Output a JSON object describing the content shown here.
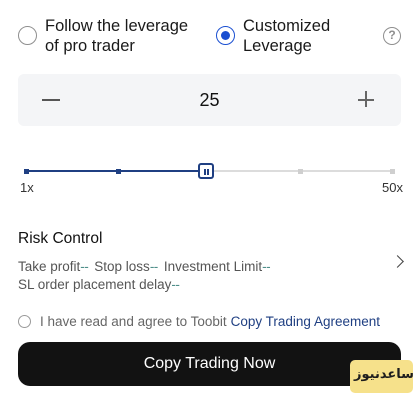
{
  "leverage_mode": {
    "options": [
      {
        "label": "Follow the leverage\nof pro trader",
        "selected": false
      },
      {
        "label": "Customized\nLeverage",
        "selected": true
      }
    ],
    "help_icon": "question-circle-icon",
    "help_glyph": "?"
  },
  "stepper": {
    "value": "25",
    "minus_icon": "minus-icon",
    "plus_icon": "plus-icon"
  },
  "slider": {
    "min_label": "1x",
    "max_label": "50x",
    "min": 1,
    "max": 50,
    "value": 25,
    "active_color": "#1f3f82",
    "inactive_color": "#dcdcdc"
  },
  "risk_control": {
    "title": "Risk Control",
    "take_profit_label": "Take profit",
    "take_profit_value": "--",
    "stop_loss_label": "Stop loss",
    "stop_loss_value": "--",
    "investment_limit_label": "Investment Limit",
    "investment_limit_value": "--",
    "sl_delay_label": "SL order placement delay",
    "sl_delay_value": "--",
    "chevron_icon": "chevron-right-icon"
  },
  "agreement": {
    "checked": false,
    "text": "I have read and agree to Toobit",
    "link": "Copy Trading Agreement"
  },
  "cta": {
    "label": "Copy Trading Now"
  },
  "watermark": {
    "text": "ساعدنیوز"
  },
  "colors": {
    "radio_selected": "#1a4fd1",
    "accent": "#1f3f82",
    "button_bg": "#121212",
    "watermark_bg": "#f6e18b"
  }
}
